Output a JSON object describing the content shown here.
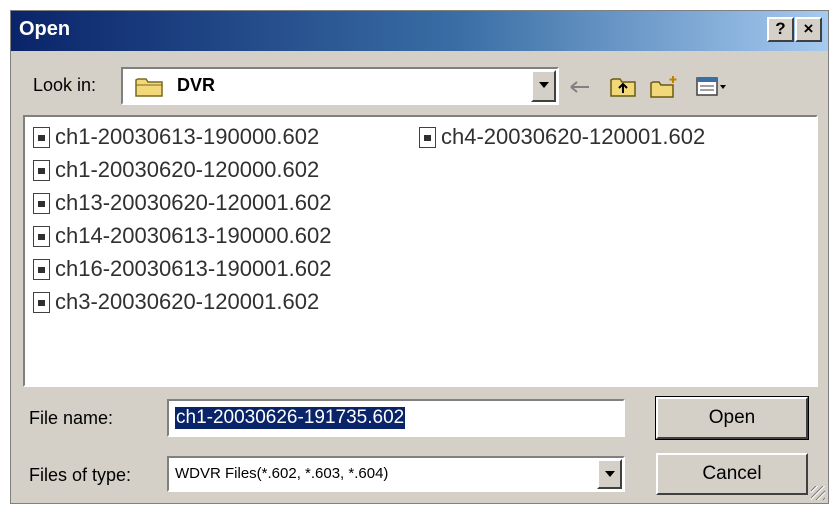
{
  "dialog": {
    "title": "Open",
    "help_label": "?",
    "close_label": "×"
  },
  "lookin": {
    "label": "Look in:",
    "value": "DVR"
  },
  "toolbar": {
    "icons": [
      "back-arrow-icon",
      "up-one-level-icon",
      "new-folder-icon",
      "view-menu-icon"
    ]
  },
  "files": [
    "ch1-20030613-190000.602",
    "ch1-20030620-120000.602",
    "ch13-20030620-120001.602",
    "ch14-20030613-190000.602",
    "ch16-20030613-190001.602",
    "ch3-20030620-120001.602",
    "ch4-20030620-120001.602"
  ],
  "filename": {
    "label": "File name:",
    "value": "ch1-20030626-191735.602"
  },
  "filetype": {
    "label": "Files of type:",
    "value": "WDVR Files(*.602, *.603, *.604)"
  },
  "buttons": {
    "open": "Open",
    "cancel": "Cancel"
  },
  "colors": {
    "title_start": "#0a246a",
    "title_end": "#a6caf0",
    "face": "#d4d0c8",
    "selection": "#0a246a"
  }
}
